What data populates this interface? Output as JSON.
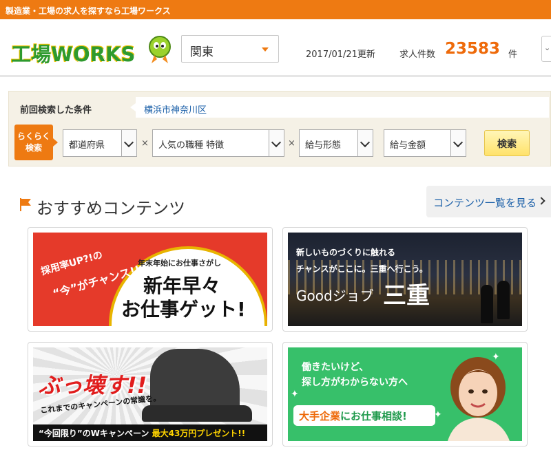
{
  "topbar": {
    "text": "製造業・工場の求人を探すなら工場ワークス"
  },
  "header": {
    "logo_text": "工場WORKS",
    "region_select": "関東",
    "updated": "2017/01/21更新",
    "count_label": "求人件数",
    "count": "23583",
    "count_unit": "件"
  },
  "search": {
    "prev_label": "前回検索した条件",
    "prev_value": "横浜市神奈川区",
    "badge_line1": "らくらく",
    "badge_line2": "検索",
    "selects": [
      "都道府県",
      "人気の職種 特徴",
      "給与形態",
      "給与金額"
    ],
    "times_symbol": "×",
    "button": "検索"
  },
  "recommend": {
    "title": "おすすめコンテンツ",
    "more_link": "コンテンツ一覧を見る"
  },
  "banners": {
    "b1": {
      "rate": "採用率UP?!の",
      "chance": "“今”がチャンス!!",
      "sub": "年末年始にお仕事さがし",
      "line1": "新年早々",
      "line2": "お仕事ゲット!"
    },
    "b2": {
      "line1": "新しいものづくりに触れる",
      "line2": "チャンスがここに。三重へ行こう。",
      "good": "Goodジョブ",
      "big": "三重"
    },
    "b3": {
      "main": "ぶっ壊す!!",
      "sub": "これまでのキャンペーンの常識を。",
      "strip_a": "“今回限り”のWキャンペーン ",
      "strip_b": "最大43万円プレゼント!!"
    },
    "b4": {
      "t1": "働きたいけど、",
      "t2": "探し方がわからない方へ",
      "bubble_a": "大手企業",
      "bubble_b": "にお仕事相談!"
    }
  },
  "colors": {
    "orange": "#ee7a12",
    "green": "#2e9a2e",
    "link": "#1a5fa8"
  }
}
